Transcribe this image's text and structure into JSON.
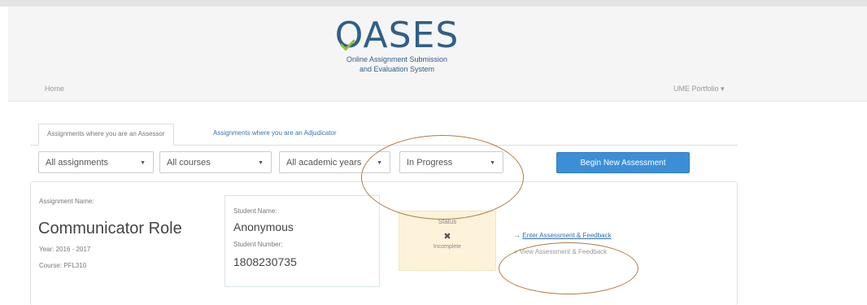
{
  "logo": {
    "name": "OASES",
    "subtitle_line1": "Online Assignment Submission",
    "subtitle_line2": "and Evaluation System"
  },
  "nav": {
    "home": "Home",
    "portfolio": "UME Portfolio ▾"
  },
  "tabs": [
    {
      "label": "Assignments where you are an Assessor",
      "active": true
    },
    {
      "label": "Assignments where you are an Adjudicator",
      "active": false
    }
  ],
  "filters": {
    "assignments": "All assignments",
    "courses": "All courses",
    "academic_years": "All academic years",
    "status": "In Progress",
    "caret": "▼"
  },
  "begin_button": "Begin New Assessment",
  "assignment": {
    "name_label": "Assignment Name:",
    "name": "Communicator Role",
    "year": "Year: 2016 - 2017",
    "course": "Course: PFL310",
    "student_name_label": "Student Name:",
    "student_name": "Anonymous",
    "student_number_label": "Student Number:",
    "student_number": "1808230735",
    "status_label": "Status",
    "status_icon": "✖",
    "status_value": "Incomplete",
    "enter_arrow": "→",
    "enter_link": "Enter Assessment & Feedback",
    "view_icon": "⌕",
    "view_link": "View Assessment & Feedback"
  },
  "colors": {
    "primary": "#3c8fd7",
    "status_bg": "#fcf3da",
    "annotation": "#b07a45",
    "logo": "#2f5f88",
    "logo_check": "#8fbe3f"
  }
}
